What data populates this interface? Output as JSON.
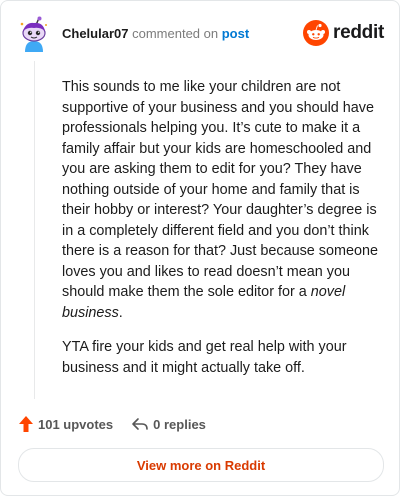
{
  "header": {
    "username": "Chelular07",
    "commented_text": "commented on",
    "post_link": "post",
    "brand": "reddit"
  },
  "comment": {
    "paragraph1_text": "This sounds to me like your children are not supportive of your business and you should have professionals helping you. It’s cute to make it a family affair but your kids are homeschooled and you are asking them to edit for you? They have nothing outside of your home and family that is their hobby or interest? Your daughter’s degree is in a completely different field and you don’t think there is a reason for that? Just because someone loves you and likes to read doesn’t mean you should make them the sole editor for a ",
    "paragraph1_emphasis": "novel business",
    "paragraph1_end": ".",
    "paragraph2_text": "YTA fire your kids and get real help with your business and it might actually take off."
  },
  "actions": {
    "upvotes_label": "101 upvotes",
    "replies_label": "0 replies"
  },
  "footer": {
    "view_more_label": "View more on Reddit"
  },
  "colors": {
    "accent": "#d93a00",
    "upvote": "#ff4500",
    "link": "#0079d3"
  },
  "icons": {
    "upvote": "arrow-up-icon",
    "reply": "reply-arrow-icon",
    "brand": "reddit-snoo-icon"
  }
}
